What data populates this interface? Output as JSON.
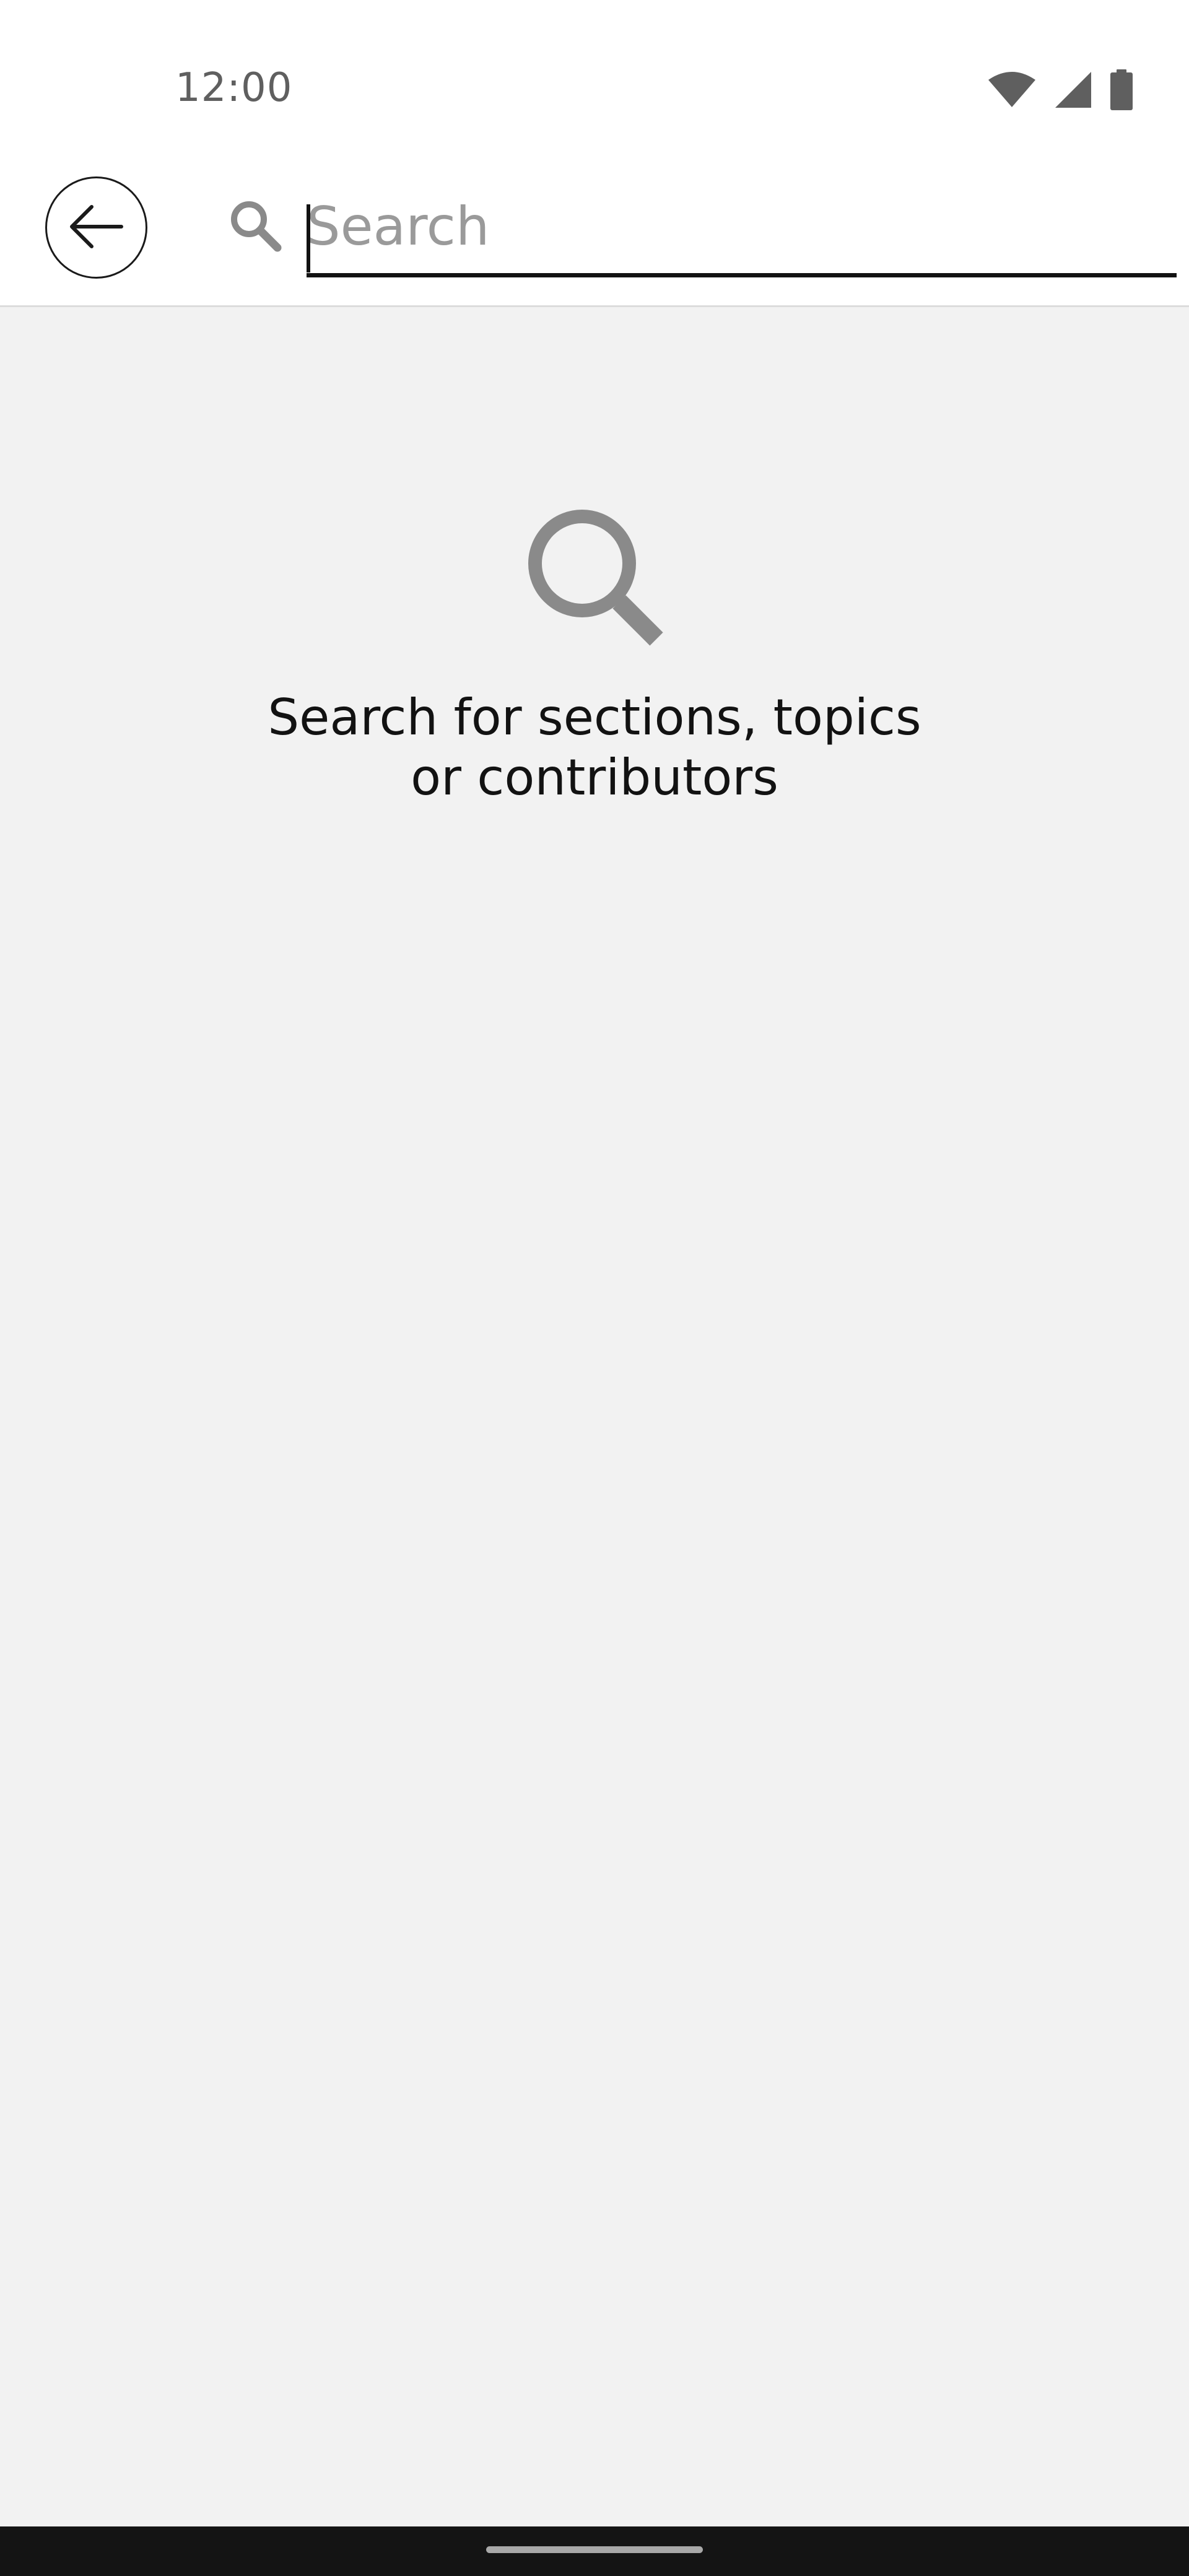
{
  "status_bar": {
    "time": "12:00",
    "icons": [
      "wifi-icon",
      "cellular-signal-icon",
      "battery-icon"
    ]
  },
  "app_bar": {
    "back_icon": "arrow-left-icon",
    "search_icon": "search-icon",
    "search": {
      "value": "",
      "placeholder": "Search"
    }
  },
  "empty_state": {
    "icon": "search-icon",
    "message": "Search for sections, topics or contributors"
  },
  "colors": {
    "background": "#f2f2f2",
    "surface": "#ffffff",
    "text": "#121212",
    "icon_gray": "#8a8a8a",
    "nav_bar": "#141414"
  }
}
